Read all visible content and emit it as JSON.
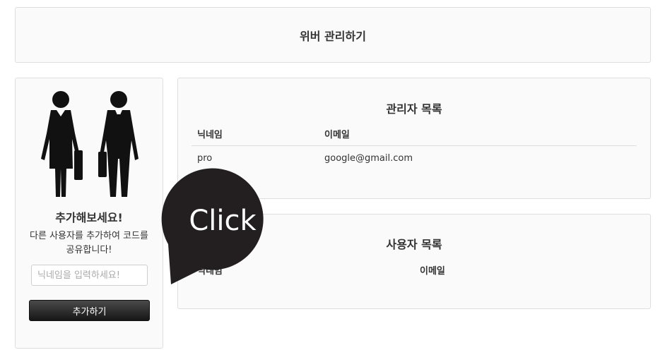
{
  "header": {
    "title": "위버 관리하기"
  },
  "side": {
    "title": "추가해보세요!",
    "description": "다른 사용자를 추가하여 코드를 공유합니다!",
    "input_placeholder": "닉네임을 입력하세요!",
    "add_button": "추가하기",
    "illustration": "business-people-icon"
  },
  "admin_list": {
    "title": "관리자 목록",
    "columns": [
      "닉네임",
      "이메일"
    ],
    "rows": [
      {
        "nickname": "pro",
        "email": "google@gmail.com"
      }
    ]
  },
  "user_list": {
    "title": "사용자 목록",
    "columns": [
      "닉네임",
      "이메일"
    ],
    "rows": []
  },
  "callout": {
    "text": "Click",
    "color": "#231f20"
  }
}
